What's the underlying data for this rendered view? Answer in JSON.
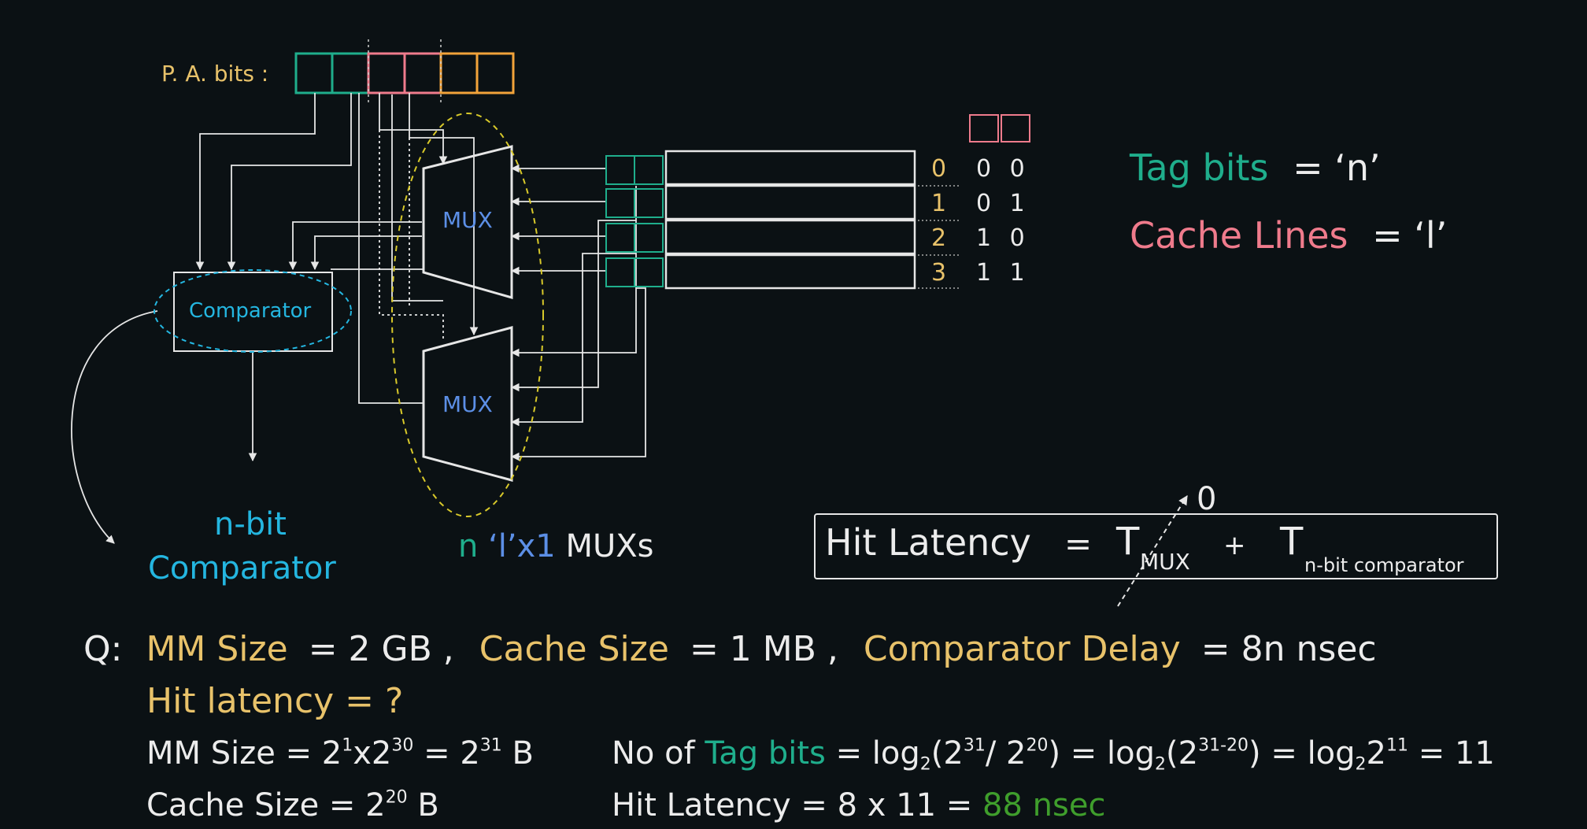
{
  "diagram": {
    "pa_label": "P. A. bits :",
    "mux_labels": [
      "MUX",
      "MUX"
    ],
    "comparator_label": "Comparator",
    "line_numbers": [
      "0",
      "1",
      "2",
      "3"
    ],
    "line_binary": [
      "0 0",
      "0 1",
      "1 0",
      "1 1"
    ],
    "nbit_line1": "n-bit",
    "nbit_line2": "Comparator",
    "muxs_n": "n",
    "muxs_l": "‘l’x1",
    "muxs_text": "MUXs",
    "colors": {
      "teal": "#1fae8c",
      "pink": "#ef7b8c",
      "orange": "#f2a33a",
      "cyan": "#24b6e0",
      "yellow_dash": "#d8c92a"
    }
  },
  "defs": {
    "tag_label": "Tag bits",
    "tag_value": "=  ‘n’",
    "lines_label": "Cache Lines",
    "lines_value": "=  ‘l’"
  },
  "formula": {
    "lhs": "Hit Latency",
    "eq": "=",
    "t1": "T",
    "t1_sub": "MUX",
    "plus": "+",
    "t2": "T",
    "t2_sub": "n-bit comparator",
    "zero_annotation": "0"
  },
  "question": {
    "q": "Q:",
    "mm_label": "MM Size",
    "mm_value": "=  2 GB ,",
    "cache_label": "Cache Size",
    "cache_value": "=  1 MB ,",
    "comp_label": "Comparator Delay",
    "comp_value": "=  8n   nsec",
    "hit_label": "Hit latency  =  ?"
  },
  "solution": {
    "mm_size": {
      "pre": "MM Size  =  2",
      "e1": "1",
      "mid": "x2",
      "e2": "30",
      "eq": " =  2",
      "e3": "31",
      "post": " B"
    },
    "cache_size": {
      "pre": "Cache Size  =  2",
      "e1": "20",
      "post": " B"
    },
    "tag_bits": {
      "pre": "No of ",
      "hl": "Tag bits",
      "a": " = log",
      "s1": "2",
      "b": "(2",
      "e1": "31",
      "c": "/ 2",
      "e2": "20",
      "d": ")  =  log",
      "s2": "2",
      "e": "(2",
      "e3": "31-20",
      "f": ")  =  log",
      "s3": "2",
      "g": "2",
      "e4": "11",
      "h": "  =  11"
    },
    "hit_latency": {
      "pre": "Hit Latency  =  8 x 11  =  ",
      "result": "88 nsec"
    }
  }
}
